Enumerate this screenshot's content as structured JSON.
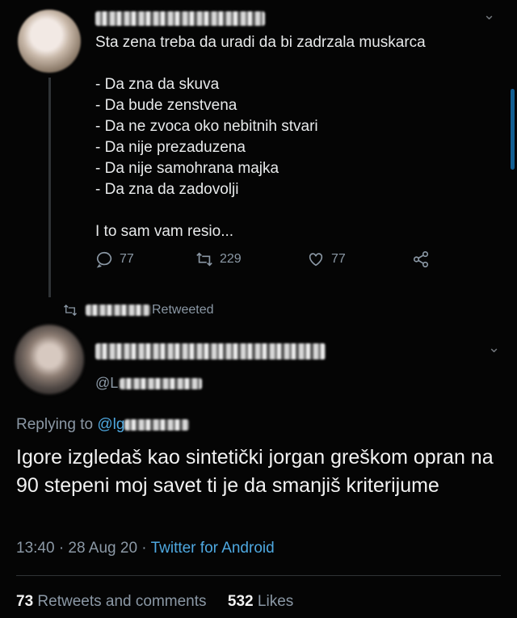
{
  "tweet1": {
    "text": "Sta zena treba da uradi da bi zadrzala muskarca\n\n- Da zna da skuva\n- Da bude zenstvena\n- Da ne zvoca oko nebitnih stvari\n- Da nije prezaduzena\n- Da nije samohrana majka\n- Da zna da zadovolji\n\nI to sam vam resio...",
    "replies": "77",
    "retweets": "229",
    "likes": "77"
  },
  "retweet_label": "Retweeted",
  "main_tweet": {
    "handle": "@L",
    "replying_to_label": "Replying to",
    "replying_to_handle": "@lg",
    "text": "Igore izgledaš kao sintetički jorgan greškom opran na 90 stepeni moj savet ti je da smanjiš kriterijume",
    "time": "13:40 · 28 Aug 20 · ",
    "source": "Twitter for Android",
    "retweets_count": "73",
    "retweets_label": "Retweets and comments",
    "likes_count": "532",
    "likes_label": "Likes"
  },
  "icons": {
    "reply": "reply-icon",
    "retweet": "retweet-icon",
    "like": "heart-icon",
    "share": "share-icon",
    "chevron": "chevron-down-icon"
  }
}
